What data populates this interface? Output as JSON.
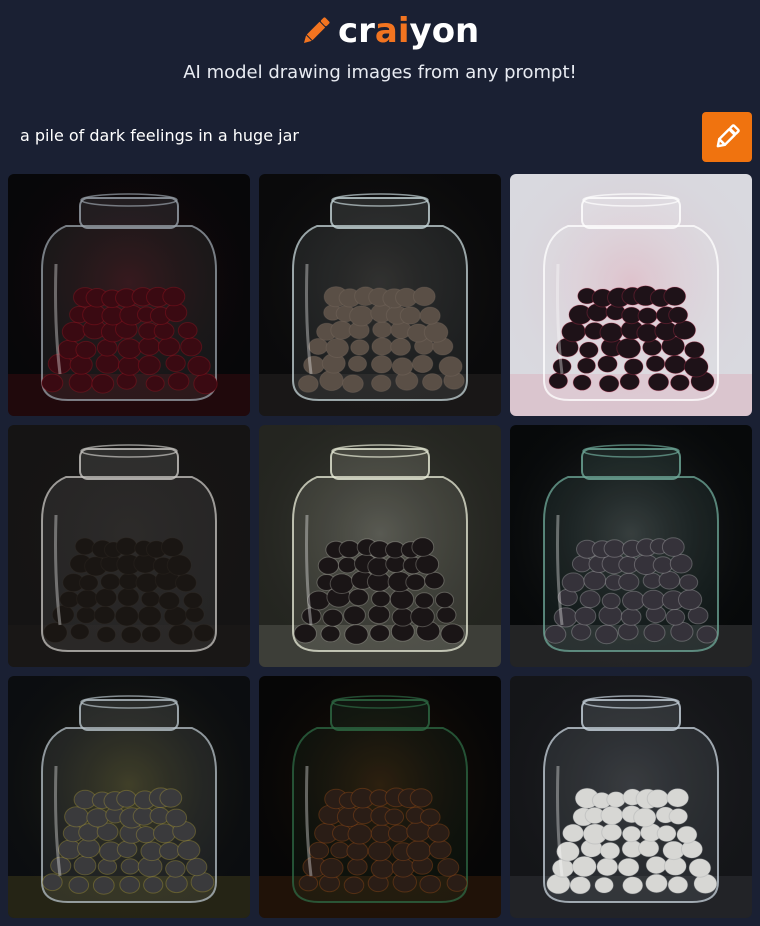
{
  "logo": {
    "prefix": "cr",
    "accent": "ai",
    "suffix": "yon",
    "icon": "pencil-icon"
  },
  "tagline": "AI model drawing images from any prompt!",
  "prompt": {
    "value": "a pile of dark feelings in a huge jar",
    "button_icon": "pencil-icon"
  },
  "colors": {
    "background": "#1a2033",
    "accent": "#f0730f"
  },
  "images": [
    {
      "id": "image-1",
      "bg": "#070709",
      "glass": "#9aa3ab",
      "item": "#3a0a12",
      "highlight": "#d41a2a"
    },
    {
      "id": "image-2",
      "bg": "#0a0a0b",
      "glass": "#c6d6d8",
      "item": "#5a4f46",
      "highlight": "#8a7d70"
    },
    {
      "id": "image-3",
      "bg": "#d9d9df",
      "glass": "#ffffff",
      "item": "#1e1218",
      "highlight": "#e4385a"
    },
    {
      "id": "image-4",
      "bg": "#151414",
      "glass": "#c8c6c2",
      "item": "#1a1613",
      "highlight": "#3a332c"
    },
    {
      "id": "image-5",
      "bg": "#242520",
      "glass": "#e9ecd8",
      "item": "#1a1516",
      "highlight": "#f3f4e6"
    },
    {
      "id": "image-6",
      "bg": "#07090a",
      "glass": "#6faa9a",
      "item": "#35323a",
      "highlight": "#f2f2f2"
    },
    {
      "id": "image-7",
      "bg": "#0b0d10",
      "glass": "#b7c2c8",
      "item": "#3a3a3c",
      "highlight": "#e6d13a"
    },
    {
      "id": "image-8",
      "bg": "#060606",
      "glass": "#2e6a44",
      "item": "#2a1d16",
      "highlight": "#e06a1a"
    },
    {
      "id": "image-9",
      "bg": "#141518",
      "glass": "#c9d4de",
      "item": "#d7d7d4",
      "highlight": "#8d8f94"
    }
  ]
}
